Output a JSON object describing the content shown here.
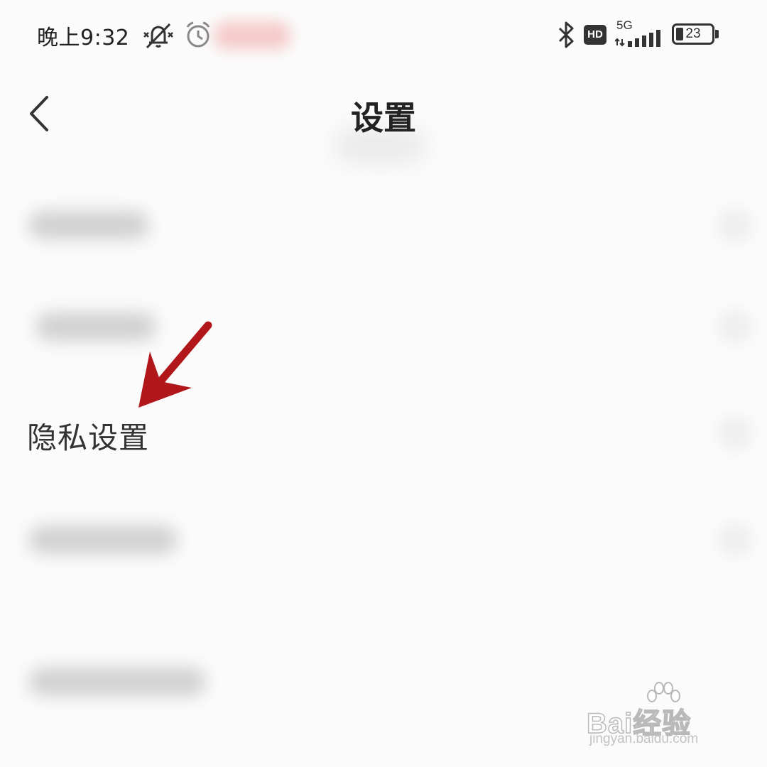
{
  "status_bar": {
    "time": "晚上9:32",
    "network_type": "5G",
    "hd_label": "HD",
    "battery_level": "23"
  },
  "header": {
    "title": "设置"
  },
  "settings_list": {
    "privacy_label": "隐私设置"
  },
  "watermark": {
    "brand": "Bai经验",
    "url": "jingyan.baidu.com"
  },
  "colors": {
    "background": "#fbfbfb",
    "text_primary": "#222222",
    "annotation_arrow": "#b0161a"
  }
}
